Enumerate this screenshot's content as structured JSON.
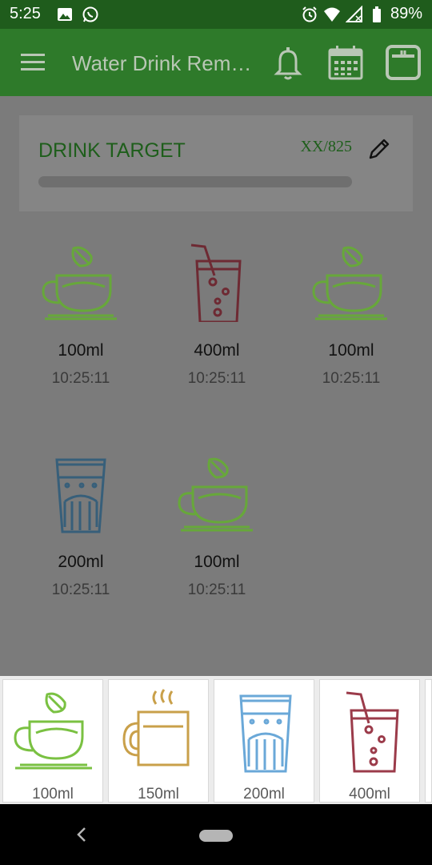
{
  "status_bar": {
    "time": "5:25",
    "battery": "89%",
    "left_icons": [
      "image-icon",
      "whatsapp-icon"
    ],
    "right_icons": [
      "alarm-icon",
      "wifi-icon",
      "signal-icon",
      "battery-icon"
    ]
  },
  "app_bar": {
    "title": "Water Drink Reminder",
    "actions": [
      "bell-icon",
      "calendar-icon",
      "scale-icon"
    ]
  },
  "target": {
    "title": "DRINK TARGET",
    "count": "XX/825",
    "progress": 0
  },
  "entries": [
    {
      "amount": "100ml",
      "time": "10:25:11",
      "icon": "tea-cup-icon"
    },
    {
      "amount": "400ml",
      "time": "10:25:11",
      "icon": "soda-glass-icon"
    },
    {
      "amount": "100ml",
      "time": "10:25:11",
      "icon": "tea-cup-icon"
    },
    {
      "amount": "200ml",
      "time": "10:25:11",
      "icon": "water-glass-icon"
    },
    {
      "amount": "100ml",
      "time": "10:25:11",
      "icon": "tea-cup-icon"
    }
  ],
  "picker": [
    {
      "label": "100ml",
      "icon": "tea-cup-icon"
    },
    {
      "label": "150ml",
      "icon": "coffee-mug-icon"
    },
    {
      "label": "200ml",
      "icon": "water-glass-icon"
    },
    {
      "label": "400ml",
      "icon": "soda-glass-icon"
    }
  ],
  "colors": {
    "status_bar": "#1f5c1c",
    "app_bar": "#2e7a2a",
    "overlay": "#7b7b7b",
    "tea_green": "#7ac142",
    "coffee_gold": "#c9a04a",
    "water_blue": "#6aa8d8",
    "soda_red": "#9b3b4a"
  }
}
